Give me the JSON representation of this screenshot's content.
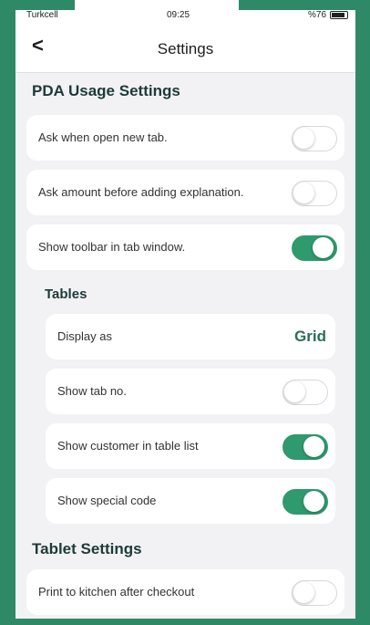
{
  "status_bar": {
    "carrier": "Turkcell",
    "time": "09:25",
    "battery": "%76"
  },
  "navbar": {
    "back_icon": "chevron-left-icon",
    "back_glyph": "<",
    "title": "Settings"
  },
  "pda_section": {
    "title": "PDA Usage Settings",
    "rows": [
      {
        "label": "Ask when open new tab.",
        "on": false
      },
      {
        "label": "Ask amount before adding explanation.",
        "on": false
      },
      {
        "label": "Show toolbar in tab window.",
        "on": true
      }
    ]
  },
  "tables": {
    "title": "Tables",
    "display_as": {
      "label": "Display as",
      "value": "Grid"
    },
    "rows": [
      {
        "label": "Show tab no.",
        "on": false
      },
      {
        "label": "Show customer in table list",
        "on": true
      },
      {
        "label": "Show special code",
        "on": true
      }
    ]
  },
  "tablet_section": {
    "title": "Tablet Settings",
    "rows": [
      {
        "label": "Print to kitchen after checkout",
        "on": false
      }
    ]
  },
  "colors": {
    "accent": "#2e9a6e",
    "background": "#2e8a66"
  }
}
